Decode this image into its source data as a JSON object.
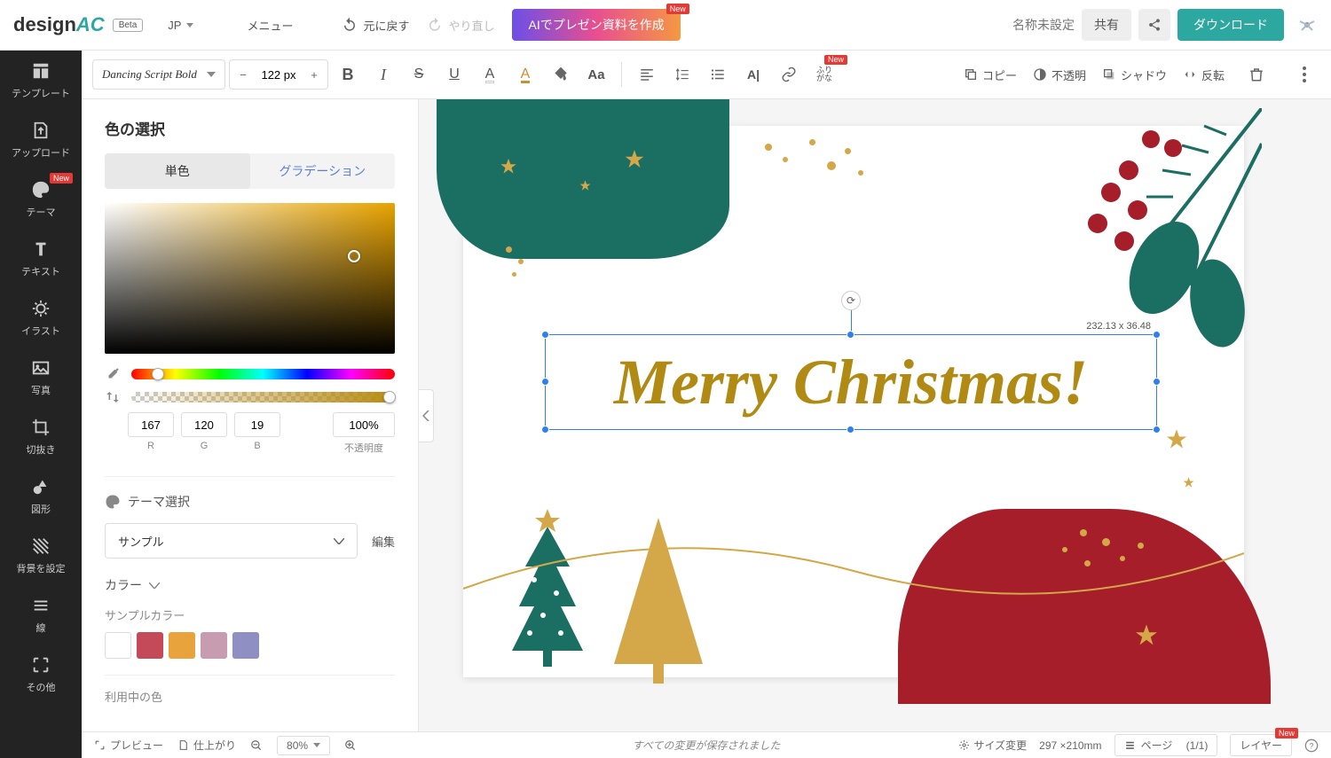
{
  "logo": {
    "text_prefix": "design",
    "text_suffix": "AC",
    "beta": "Beta"
  },
  "lang": "JP",
  "topbar": {
    "menu": "メニュー",
    "undo": "元に戻す",
    "redo": "やり直し",
    "ai_button": "AIでプレゼン資料を作成",
    "new_badge": "New",
    "title_placeholder": "名称未設定",
    "share": "共有",
    "download": "ダウンロード"
  },
  "toolbar": {
    "font_name": "Dancing Script Bold",
    "font_size": "122 px",
    "furigana": "ふり\nがな",
    "copy": "コピー",
    "opacity": "不透明",
    "shadow": "シャドウ",
    "flip": "反転"
  },
  "sidebar": {
    "template": "テンプレート",
    "upload": "アップロード",
    "theme": "テーマ",
    "text": "テキスト",
    "illust": "イラスト",
    "photo": "写真",
    "crop": "切抜き",
    "shape": "図形",
    "bg": "背景を設定",
    "line": "線",
    "other": "その他"
  },
  "panel": {
    "title": "色の選択",
    "tab_solid": "単色",
    "tab_gradient": "グラデーション",
    "rgb": {
      "r": "167",
      "g": "120",
      "b": "19",
      "a": "100%"
    },
    "rgb_labels": {
      "r": "R",
      "g": "G",
      "b": "B",
      "a": "不透明度"
    },
    "theme_select_label": "テーマ選択",
    "theme_value": "サンプル",
    "edit": "編集",
    "color_section": "カラー",
    "sample_color": "サンプルカラー",
    "used_color": "利用中の色",
    "swatches": [
      "#ffffff",
      "#C44A5A",
      "#E8A33D",
      "#C79BB0",
      "#8F8FC4"
    ]
  },
  "canvas": {
    "text": "Merry Christmas!",
    "selection_dim": "232.13 x 36.48"
  },
  "bottombar": {
    "preview": "プレビュー",
    "finish": "仕上がり",
    "zoom": "80%",
    "saved": "すべての変更が保存されました",
    "resize": "サイズ変更",
    "page_size": "297 ×210mm",
    "page_label": "ページ",
    "page_count": "(1/1)",
    "layer": "レイヤー",
    "new_badge": "New"
  }
}
